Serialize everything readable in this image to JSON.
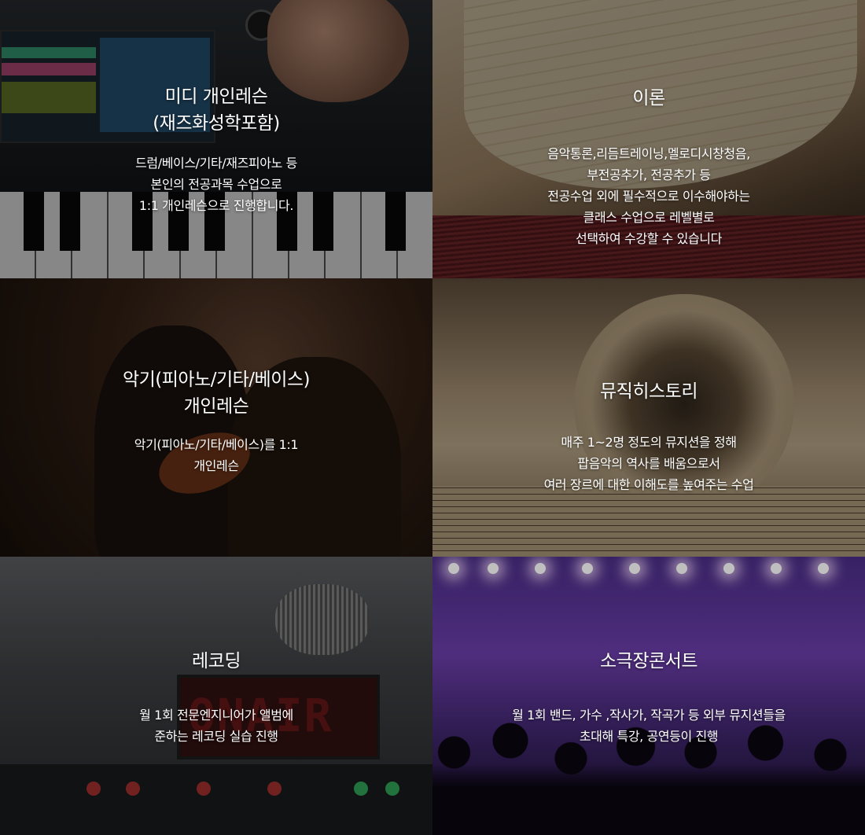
{
  "tiles": [
    {
      "title": "미디 개인레슨\n(재즈화성학포함)",
      "description": "드럼/베이스/기타/재즈피아노 등\n본인의 전공과목 수업으로\n1:1 개인레슨으로 진행합니다."
    },
    {
      "title": "이론",
      "description": "음악통론,리듬트레이닝,멜로디시창청음,\n부전공추가, 전공추가 등\n전공수업 외에 필수적으로 이수해야하는\n클래스 수업으로 레벨별로\n선택하여 수강할 수 있습니다"
    },
    {
      "title": "악기(피아노/기타/베이스)\n개인레슨",
      "description": "악기(피아노/기타/베이스)를 1:1\n개인레슨"
    },
    {
      "title": "뮤직히스토리",
      "description": "매주 1~2명 정도의 뮤지션을 정해\n팝음악의 역사를 배움으로서\n여러 장르에 대한 이해도를 높여주는 수업"
    },
    {
      "title": "레코딩",
      "description": "월 1회 전문엔지니어가 앨범에\n준하는 레코딩 실습 진행"
    },
    {
      "title": "소극장콘서트",
      "description": "월 1회 밴드, 가수 ,작사가, 작곡가 등 외부 뮤지션들을\n초대해 특강, 공연등이 진행"
    }
  ],
  "backdrop_text": {
    "on_air_sign": "ONAIR"
  }
}
